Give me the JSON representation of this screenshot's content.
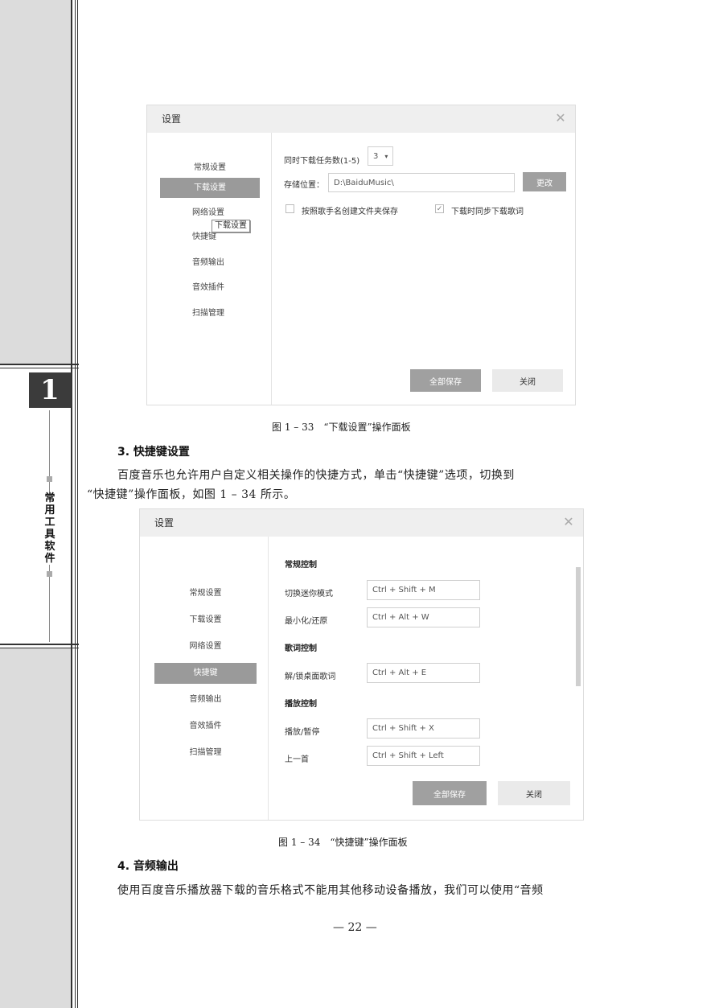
{
  "sidebar": {
    "vertical_title": "常用工具软件",
    "logo_glyph": "1"
  },
  "figure1": {
    "window_title": "设置",
    "close_glyph": "✕",
    "menu": [
      "常规设置",
      "下载设置",
      "网络设置",
      "快捷键",
      "音频输出",
      "音效插件",
      "扫描管理"
    ],
    "selected_index": 1,
    "tooltip": "下载设置",
    "tasks_label": "同时下载任务数(1-5)",
    "tasks_value": "3",
    "tasks_arrow": "▾",
    "storage_label": "存储位置：",
    "storage_value": "D:\\BaiduMusic\\",
    "change_button": "更改",
    "checkbox1_label": "按照歌手名创建文件夹保存",
    "checkbox1_checked": false,
    "checkbox2_label": "下载时同步下载歌词",
    "checkbox2_checked": true,
    "check_glyph": "✓",
    "save_all": "全部保存",
    "close": "关闭",
    "caption": "图 1 – 33　“下载设置”操作面板"
  },
  "section3": {
    "heading": "3. 快捷键设置",
    "paragraph_line1": "百度音乐也允许用户自定义相关操作的快捷方式，单击“快捷键”选项，切换到",
    "paragraph_line2": "“快捷键”操作面板，如图 1 – 34 所示。"
  },
  "figure2": {
    "window_title": "设置",
    "close_glyph": "✕",
    "menu": [
      "常规设置",
      "下载设置",
      "网络设置",
      "快捷键",
      "音频输出",
      "音效插件",
      "扫描管理"
    ],
    "selected_index": 3,
    "groups": {
      "general": "常规控制",
      "lyrics": "歌词控制",
      "playback": "播放控制"
    },
    "shortcuts": [
      {
        "label": "切换迷你模式",
        "value": "Ctrl + Shift + M"
      },
      {
        "label": "最小化/还原",
        "value": "Ctrl + Alt + W"
      },
      {
        "label": "解/锁桌面歌词",
        "value": "Ctrl + Alt + E"
      },
      {
        "label": "播放/暂停",
        "value": "Ctrl + Shift + X"
      },
      {
        "label": "上一首",
        "value": "Ctrl + Shift + Left"
      }
    ],
    "save_all": "全部保存",
    "close": "关闭",
    "caption": "图 1 – 34　“快捷键”操作面板"
  },
  "section4": {
    "heading": "4. 音频输出",
    "paragraph_line1": "使用百度音乐播放器下载的音乐格式不能用其他移动设备播放，我们可以使用“音频"
  },
  "page_number": "— 22 —"
}
